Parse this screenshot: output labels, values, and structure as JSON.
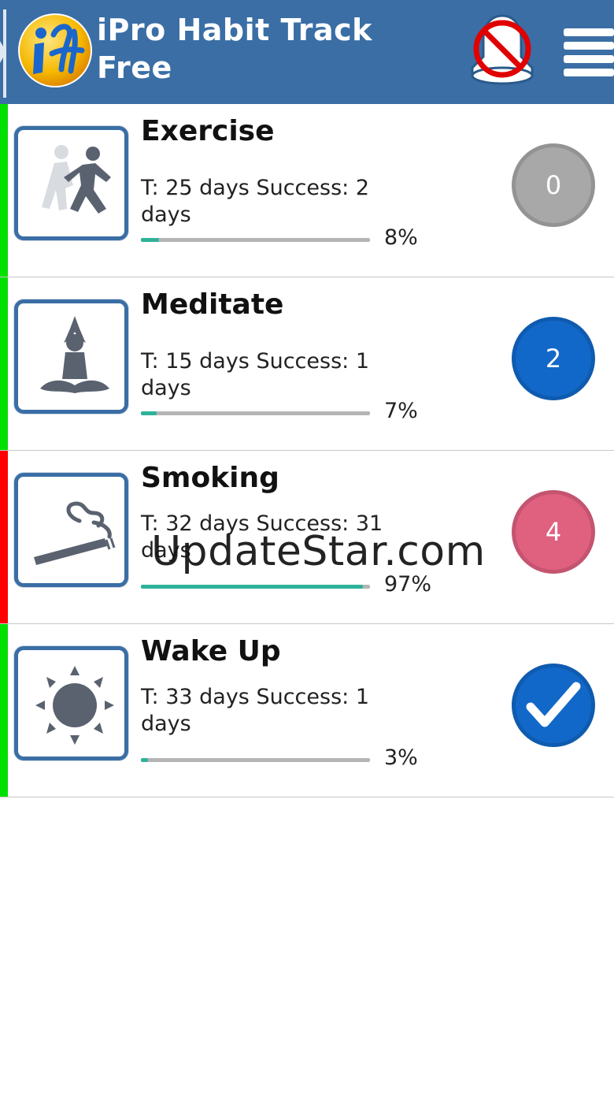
{
  "header": {
    "title_line1": "iPro Habit Track",
    "title_line2": "Free",
    "logo_icon": "ipro-habit-logo-icon",
    "bell_icon": "reminders-off-bell-icon",
    "menu_icon": "hamburger-menu-icon",
    "bg_color": "#3a6ea5"
  },
  "habits": [
    {
      "name": "Exercise",
      "stats": "T: 25 days  Success: 2 days",
      "percent_label": "8%",
      "progress": 0.08,
      "badge": "0",
      "badge_color": "#a8a8a8",
      "badge_type": "count",
      "strip_color": "#00e000",
      "icon": "running-people-icon"
    },
    {
      "name": "Meditate",
      "stats": "T: 15 days  Success: 1 days",
      "percent_label": "7%",
      "progress": 0.07,
      "badge": "2",
      "badge_color": "#1168c8",
      "badge_type": "count",
      "strip_color": "#00e000",
      "icon": "meditation-pose-icon"
    },
    {
      "name": "Smoking",
      "stats": "T: 32 days  Success: 31 days",
      "percent_label": "97%",
      "progress": 0.97,
      "badge": "4",
      "badge_color": "#e06080",
      "badge_type": "count",
      "strip_color": "#ff0000",
      "icon": "cigarette-icon"
    },
    {
      "name": "Wake Up",
      "stats": "T: 33 days  Success: 1 days",
      "percent_label": "3%",
      "progress": 0.03,
      "badge": "",
      "badge_color": "#1168c8",
      "badge_type": "check",
      "strip_color": "#00e000",
      "icon": "sun-icon"
    }
  ],
  "watermark": "UpdateStar.com"
}
